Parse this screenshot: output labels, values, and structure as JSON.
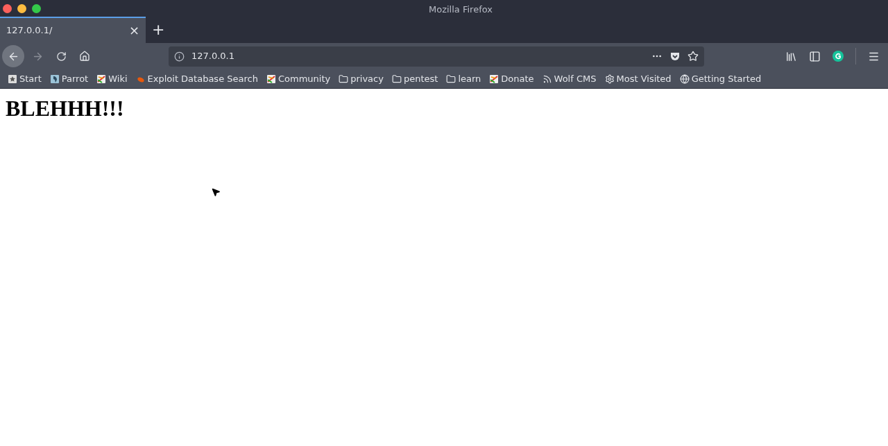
{
  "window": {
    "title": "Mozilla Firefox"
  },
  "tabs": [
    {
      "label": "127.0.0.1/",
      "selected": true,
      "close": "×"
    }
  ],
  "new_tab": "+",
  "address_bar": {
    "value": "127.0.0.1"
  },
  "bookmarks": [
    {
      "label": "Start",
      "kind": "page"
    },
    {
      "label": "Parrot",
      "kind": "parrot"
    },
    {
      "label": "Wiki",
      "kind": "colorful"
    },
    {
      "label": "Exploit Database Search",
      "kind": "exploit"
    },
    {
      "label": "Community",
      "kind": "colorful"
    },
    {
      "label": "privacy",
      "kind": "folder"
    },
    {
      "label": "pentest",
      "kind": "folder"
    },
    {
      "label": "learn",
      "kind": "folder"
    },
    {
      "label": "Donate",
      "kind": "colorful"
    },
    {
      "label": "Wolf CMS",
      "kind": "feed"
    },
    {
      "label": "Most Visited",
      "kind": "gear"
    },
    {
      "label": "Getting Started",
      "kind": "globe"
    }
  ],
  "page": {
    "heading": "BLEHHH!!!"
  }
}
